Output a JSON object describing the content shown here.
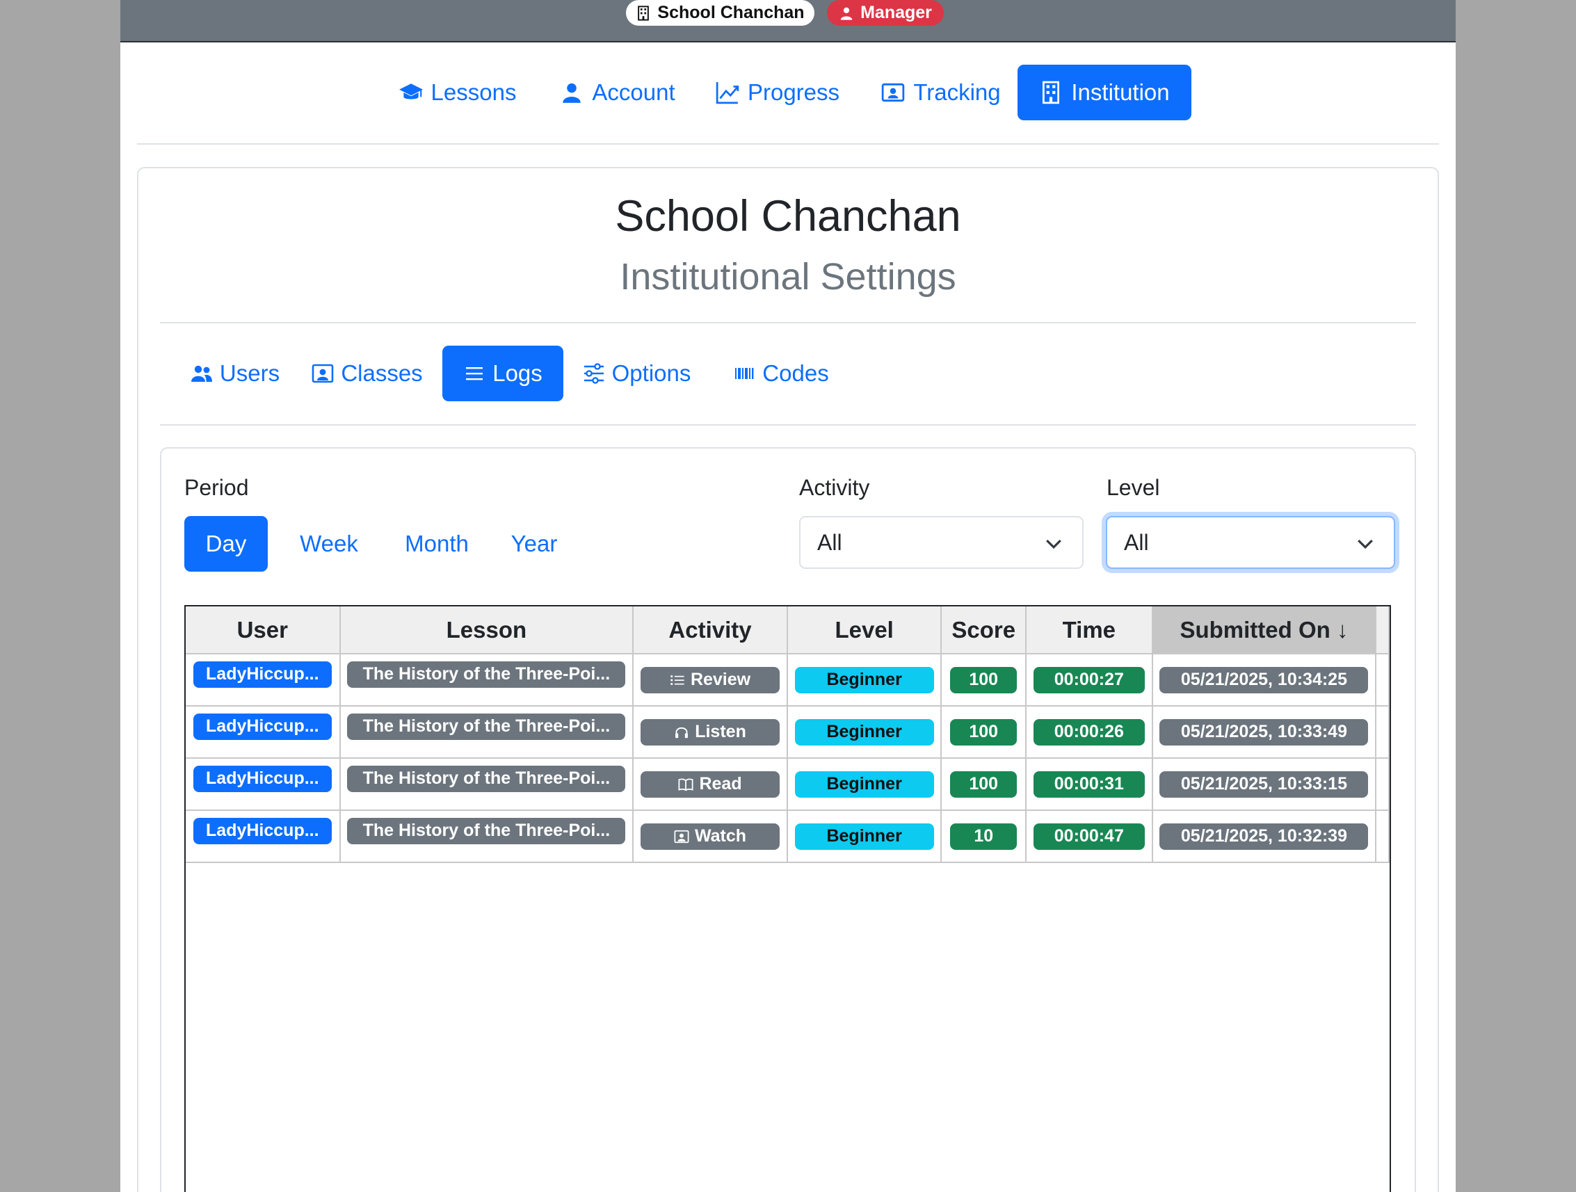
{
  "header": {
    "institution_badge": "School Chanchan",
    "role_badge": "Manager"
  },
  "main_nav": [
    {
      "label": "Lessons",
      "icon": "graduation-cap-icon",
      "active": false
    },
    {
      "label": "Account",
      "icon": "person-icon",
      "active": false
    },
    {
      "label": "Progress",
      "icon": "line-chart-icon",
      "active": false
    },
    {
      "label": "Tracking",
      "icon": "person-badge-icon",
      "active": false
    },
    {
      "label": "Institution",
      "icon": "building-icon",
      "active": true
    }
  ],
  "page": {
    "title": "School Chanchan",
    "subtitle": "Institutional Settings"
  },
  "sub_nav": [
    {
      "label": "Users",
      "icon": "people-icon",
      "active": false
    },
    {
      "label": "Classes",
      "icon": "person-video-icon",
      "active": false
    },
    {
      "label": "Logs",
      "icon": "list-icon",
      "active": true
    },
    {
      "label": "Options",
      "icon": "sliders-icon",
      "active": false
    },
    {
      "label": "Codes",
      "icon": "barcode-icon",
      "active": false
    }
  ],
  "filters": {
    "period_label": "Period",
    "period_options": [
      "Day",
      "Week",
      "Month",
      "Year"
    ],
    "period_selected": "Day",
    "activity_label": "Activity",
    "activity_value": "All",
    "level_label": "Level",
    "level_value": "All"
  },
  "table": {
    "columns": [
      "User",
      "Lesson",
      "Activity",
      "Level",
      "Score",
      "Time",
      "Submitted On ↓"
    ],
    "sorted_column": "Submitted On",
    "rows": [
      {
        "user": "LadyHiccup...",
        "lesson": "The History of the Three-Poi...",
        "activity": "Review",
        "activity_icon": "list-icon",
        "level": "Beginner",
        "score": "100",
        "time": "00:00:27",
        "submitted": "05/21/2025, 10:34:25"
      },
      {
        "user": "LadyHiccup...",
        "lesson": "The History of the Three-Poi...",
        "activity": "Listen",
        "activity_icon": "headphones-icon",
        "level": "Beginner",
        "score": "100",
        "time": "00:00:26",
        "submitted": "05/21/2025, 10:33:49"
      },
      {
        "user": "LadyHiccup...",
        "lesson": "The History of the Three-Poi...",
        "activity": "Read",
        "activity_icon": "book-icon",
        "level": "Beginner",
        "score": "100",
        "time": "00:00:31",
        "submitted": "05/21/2025, 10:33:15"
      },
      {
        "user": "LadyHiccup...",
        "lesson": "The History of the Three-Poi...",
        "activity": "Watch",
        "activity_icon": "person-video-icon",
        "level": "Beginner",
        "score": "10",
        "time": "00:00:47",
        "submitted": "05/21/2025, 10:32:39"
      }
    ]
  },
  "colors": {
    "primary": "#0d6efd",
    "secondary": "#6c757d",
    "success": "#198754",
    "info": "#0dcaf0",
    "danger": "#dc3545"
  }
}
